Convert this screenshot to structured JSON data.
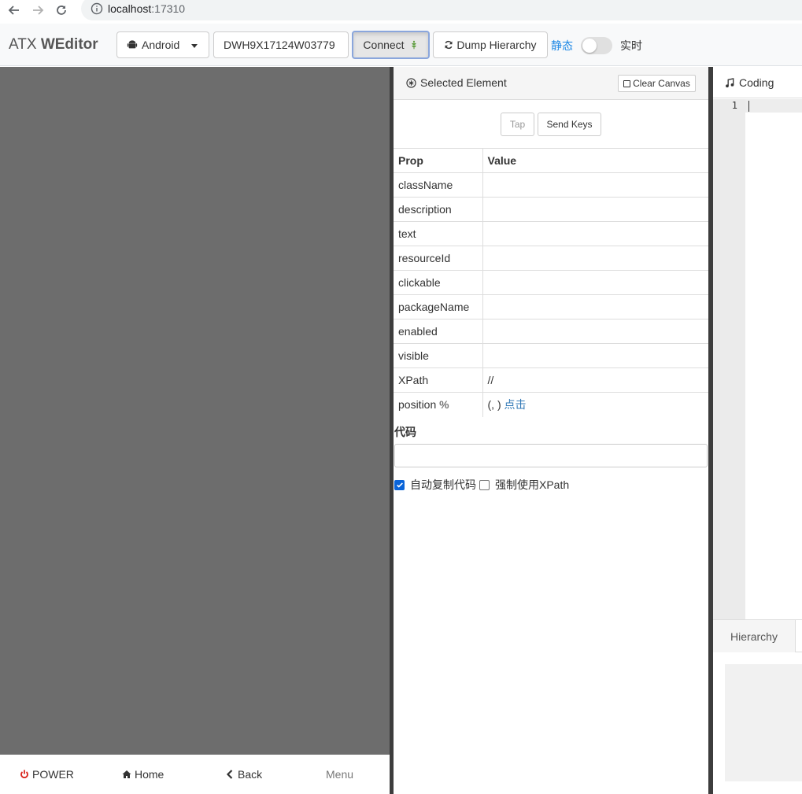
{
  "browser": {
    "url_host": "localhost",
    "url_port": ":17310"
  },
  "navbar": {
    "brand_light": "ATX ",
    "brand_bold": "WEditor",
    "platform_label": "Android",
    "serial_value": "DWH9X17124W03779",
    "connect_label": "Connect",
    "dump_label": "Dump Hierarchy",
    "mode_static": "静态",
    "mode_live": "实时"
  },
  "bottom_buttons": {
    "power": "POWER",
    "home": "Home",
    "back": "Back",
    "menu": "Menu"
  },
  "selected": {
    "title": "Selected Element",
    "clear_label": "Clear Canvas",
    "tap_label": "Tap",
    "send_keys_label": "Send Keys",
    "headers": {
      "prop": "Prop",
      "value": "Value"
    },
    "rows": [
      {
        "prop": "className",
        "value": ""
      },
      {
        "prop": "description",
        "value": ""
      },
      {
        "prop": "text",
        "value": ""
      },
      {
        "prop": "resourceId",
        "value": ""
      },
      {
        "prop": "clickable",
        "value": ""
      },
      {
        "prop": "packageName",
        "value": ""
      },
      {
        "prop": "enabled",
        "value": ""
      },
      {
        "prop": "visible",
        "value": ""
      },
      {
        "prop": "XPath",
        "value": "//"
      }
    ],
    "position_prop": "position",
    "position_pct": "%",
    "position_value": "(, )",
    "position_link": "点击",
    "code_label": "代码",
    "auto_copy_label": "自动复制代码",
    "force_xpath_label": "强制使用XPath"
  },
  "coding": {
    "title": "Coding",
    "line_number": "1",
    "hierarchy_tab": "Hierarchy"
  }
}
